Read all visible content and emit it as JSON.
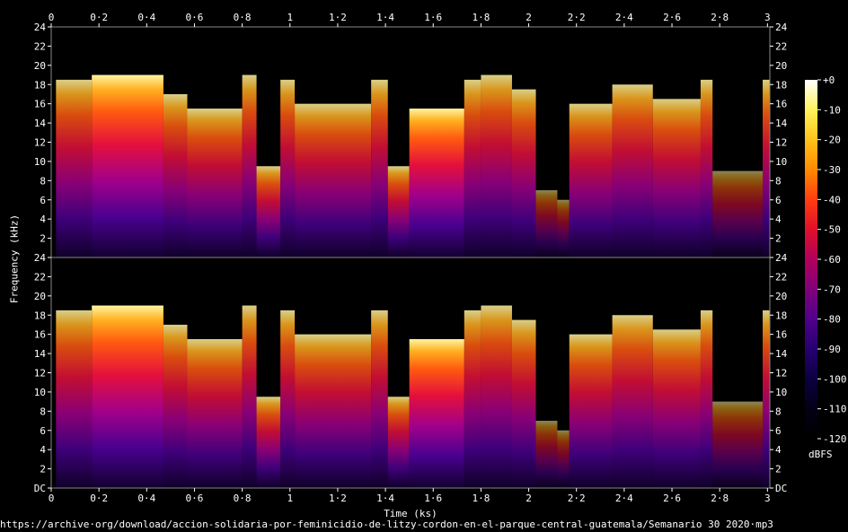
{
  "chart_data": {
    "type": "heatmap",
    "xlabel": "Time (ks)",
    "ylabel": "Frequency (kHz)",
    "xlim": [
      0,
      3.01
    ],
    "x_ticks": [
      "0",
      "0·2",
      "0·4",
      "0·6",
      "0·8",
      "1",
      "1·2",
      "1·4",
      "1·6",
      "1·8",
      "2",
      "2·2",
      "2·4",
      "2·6",
      "2·8",
      "3"
    ],
    "x_tick_values": [
      0,
      0.2,
      0.4,
      0.6,
      0.8,
      1.0,
      1.2,
      1.4,
      1.6,
      1.8,
      2.0,
      2.2,
      2.4,
      2.6,
      2.8,
      3.0
    ],
    "ylim": [
      0,
      24
    ],
    "y_ticks_top_channel": [
      "24",
      "22",
      "20",
      "18",
      "16",
      "14",
      "12",
      "10",
      "8",
      "6",
      "4",
      "2"
    ],
    "y_ticks_bottom_channel": [
      "24",
      "22",
      "20",
      "18",
      "16",
      "14",
      "12",
      "10",
      "8",
      "6",
      "4",
      "2",
      "DC"
    ],
    "channels": 2,
    "colorbar": {
      "label": "dBFS",
      "range": [
        -120,
        0
      ],
      "ticks": [
        "+0",
        "-10",
        "-20",
        "-30",
        "-40",
        "-50",
        "-60",
        "-70",
        "-80",
        "-90",
        "-100",
        "-110",
        "-120"
      ],
      "stops": [
        "#ffffff",
        "#fff35a",
        "#ffc21a",
        "#ff8a00",
        "#ff3d10",
        "#e0102a",
        "#b0005a",
        "#80007a",
        "#50008c",
        "#260070",
        "#0c0040",
        "#030015",
        "#000000"
      ]
    },
    "segments": [
      {
        "t": [
          0.0,
          0.02
        ],
        "top_khz": 0,
        "level": "silence"
      },
      {
        "t": [
          0.02,
          0.17
        ],
        "top_khz": 18.5,
        "level": "medium"
      },
      {
        "t": [
          0.17,
          0.47
        ],
        "top_khz": 19,
        "level": "high"
      },
      {
        "t": [
          0.47,
          0.57
        ],
        "top_khz": 17,
        "level": "medium"
      },
      {
        "t": [
          0.57,
          0.8
        ],
        "top_khz": 15.5,
        "level": "medium"
      },
      {
        "t": [
          0.8,
          0.86
        ],
        "top_khz": 19,
        "level": "medium"
      },
      {
        "t": [
          0.86,
          0.96
        ],
        "top_khz": 9.5,
        "level": "medium"
      },
      {
        "t": [
          0.96,
          1.02
        ],
        "top_khz": 18.5,
        "level": "medium"
      },
      {
        "t": [
          1.02,
          1.34
        ],
        "top_khz": 16,
        "level": "medium"
      },
      {
        "t": [
          1.34,
          1.41
        ],
        "top_khz": 18.5,
        "level": "medium"
      },
      {
        "t": [
          1.41,
          1.5
        ],
        "top_khz": 9.5,
        "level": "medium"
      },
      {
        "t": [
          1.5,
          1.73
        ],
        "top_khz": 15.5,
        "level": "high"
      },
      {
        "t": [
          1.73,
          1.8
        ],
        "top_khz": 18.5,
        "level": "medium"
      },
      {
        "t": [
          1.8,
          1.93
        ],
        "top_khz": 19,
        "level": "medium"
      },
      {
        "t": [
          1.93,
          2.03
        ],
        "top_khz": 17.5,
        "level": "medium"
      },
      {
        "t": [
          2.03,
          2.12
        ],
        "top_khz": 7,
        "level": "low"
      },
      {
        "t": [
          2.12,
          2.17
        ],
        "top_khz": 6,
        "level": "low"
      },
      {
        "t": [
          2.17,
          2.35
        ],
        "top_khz": 16,
        "level": "medium"
      },
      {
        "t": [
          2.35,
          2.52
        ],
        "top_khz": 18,
        "level": "medium"
      },
      {
        "t": [
          2.52,
          2.72
        ],
        "top_khz": 16.5,
        "level": "medium"
      },
      {
        "t": [
          2.72,
          2.77
        ],
        "top_khz": 18.5,
        "level": "medium"
      },
      {
        "t": [
          2.77,
          2.98
        ],
        "top_khz": 9,
        "level": "low"
      },
      {
        "t": [
          2.98,
          3.01
        ],
        "top_khz": 18.5,
        "level": "medium"
      }
    ]
  },
  "source_url": "https://archive·org/download/accion-solidaria-por-feminicidio-de-litzy-cordon-en-el-parque-central-guatemala/Semanario 30 2020·mp3"
}
